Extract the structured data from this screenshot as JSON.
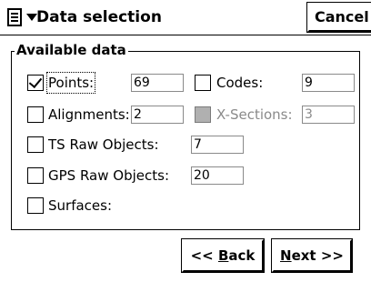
{
  "header": {
    "menu_icon": "document-menu-icon",
    "title": "Data selection",
    "cancel_label": "Cancel"
  },
  "group": {
    "legend": "Available data"
  },
  "items": {
    "points": {
      "label": "Points:",
      "value": "69",
      "checked": true
    },
    "codes": {
      "label": "Codes:",
      "value": "9",
      "checked": false
    },
    "alignments": {
      "label": "Alignments:",
      "value": "2",
      "checked": false
    },
    "xsections": {
      "label": "X-Sections:",
      "value": "3",
      "checked": false,
      "disabled": true
    },
    "ts_raw": {
      "label": "TS Raw Objects:",
      "value": "7",
      "checked": false
    },
    "gps_raw": {
      "label": "GPS Raw Objects:",
      "value": "20",
      "checked": false
    },
    "surfaces": {
      "label": "Surfaces:",
      "checked": false
    }
  },
  "nav": {
    "back_prefix": "<< ",
    "back_key": "B",
    "back_rest": "ack",
    "next_key": "N",
    "next_rest": "ext >>"
  }
}
